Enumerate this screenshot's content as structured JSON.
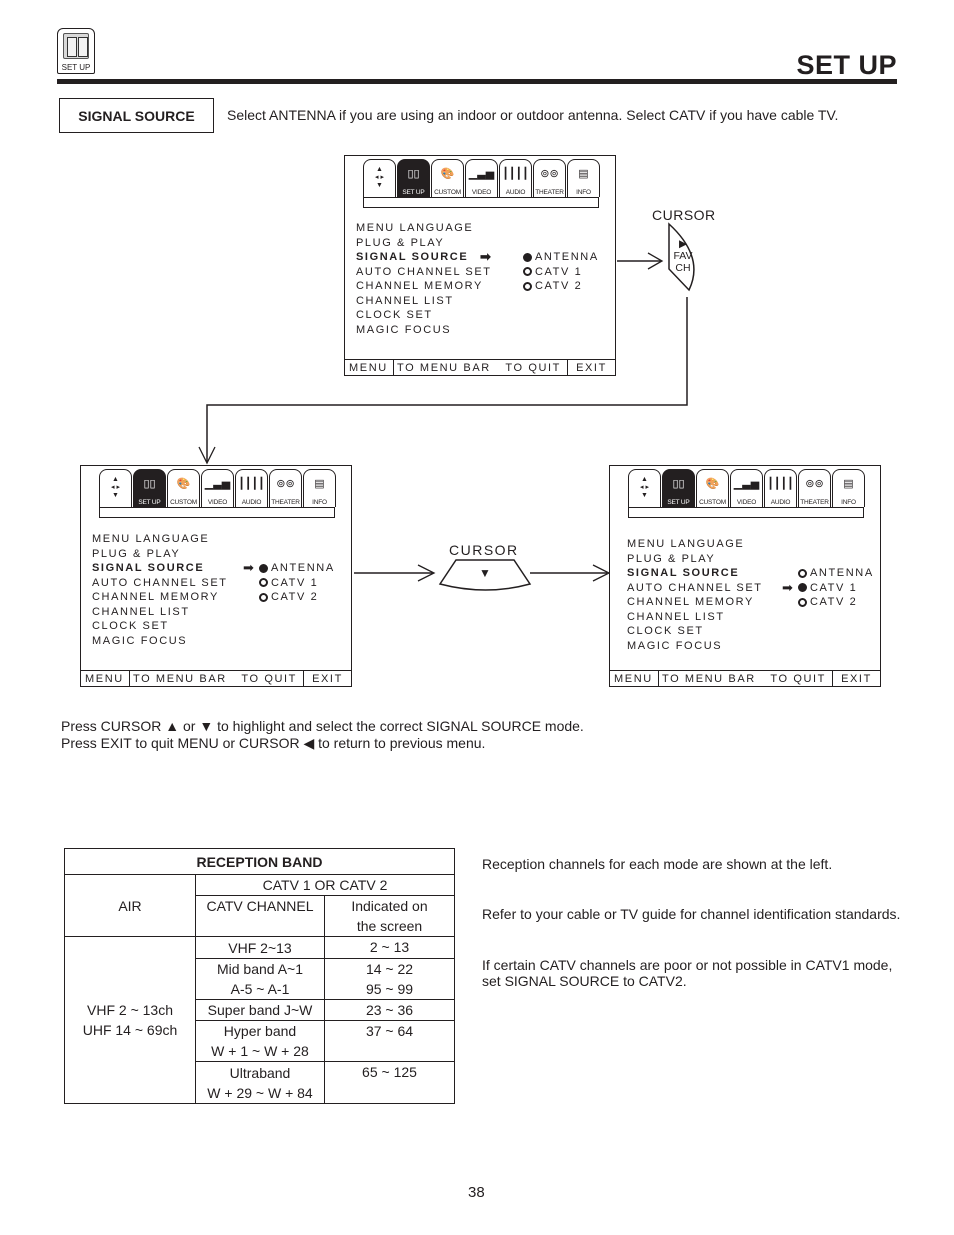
{
  "header": {
    "icon_label": "SET UP",
    "page_title": "SET UP"
  },
  "section": {
    "label": "SIGNAL SOURCE",
    "intro": "Select ANTENNA if you are using an indoor or outdoor antenna.  Select CATV if you have cable TV."
  },
  "tv_menu": {
    "tabs": [
      "SET UP",
      "CUSTOM",
      "VIDEO",
      "AUDIO",
      "THEATER",
      "INFO"
    ],
    "active_tab": "SET UP",
    "items": [
      "MENU LANGUAGE",
      "PLUG & PLAY",
      "SIGNAL SOURCE",
      "AUTO CHANNEL SET",
      "CHANNEL MEMORY",
      "CHANNEL LIST",
      "CLOCK SET",
      "MAGIC FOCUS"
    ],
    "highlighted_item": "SIGNAL SOURCE",
    "options": [
      "ANTENNA",
      "CATV 1",
      "CATV 2"
    ],
    "footer": {
      "menu": "MENU",
      "to_menu_bar": "TO MENU BAR",
      "to_quit": "TO QUIT",
      "exit": "EXIT"
    }
  },
  "screens": [
    {
      "name": "screen-1",
      "selected_option": "ANTENNA",
      "pointer_at": "SIGNAL SOURCE"
    },
    {
      "name": "screen-2",
      "selected_option": "ANTENNA",
      "pointer_at": "ANTENNA"
    },
    {
      "name": "screen-3",
      "selected_option": "CATV 1",
      "pointer_at": "CATV 1"
    }
  ],
  "buttons": {
    "cursor_right": {
      "label": "CURSOR",
      "glyph": "▶",
      "sublabel_1": "FAV",
      "sublabel_2": "CH"
    },
    "cursor_down": {
      "label": "CURSOR",
      "glyph": "▼"
    }
  },
  "instructions": [
    "Press CURSOR ▲ or ▼ to highlight and select the correct SIGNAL SOURCE mode.",
    "Press EXIT to quit MENU or CURSOR ◀ to return to previous menu."
  ],
  "reception_table": {
    "title": "RECEPTION BAND",
    "air_header": "AIR",
    "catv_header": "CATV 1 OR CATV 2",
    "catv_channel_header": "CATV CHANNEL",
    "indicated_header_1": "Indicated on",
    "indicated_header_2": "the screen",
    "air_values": [
      "VHF 2 ~ 13ch",
      "UHF 14 ~ 69ch"
    ],
    "rows": [
      {
        "channel": [
          "VHF 2~13"
        ],
        "indicated": [
          "2 ~ 13"
        ]
      },
      {
        "channel": [
          "Mid band A~1",
          "A-5 ~ A-1"
        ],
        "indicated": [
          "14 ~ 22",
          "95 ~ 99"
        ]
      },
      {
        "channel": [
          "Super band J~W"
        ],
        "indicated": [
          "23 ~ 36"
        ]
      },
      {
        "channel": [
          "Hyper band",
          "W + 1 ~ W + 28"
        ],
        "indicated": [
          "37 ~ 64"
        ]
      },
      {
        "channel": [
          "Ultraband",
          "W + 29 ~ W + 84"
        ],
        "indicated": [
          "65 ~ 125"
        ]
      }
    ]
  },
  "notes": [
    "Reception channels for each mode are shown at the left.",
    "Refer to your cable or TV guide for channel identification standards.",
    "If certain CATV channels are poor or not possible in CATV1 mode, set SIGNAL SOURCE to CATV2."
  ],
  "page_number": "38"
}
